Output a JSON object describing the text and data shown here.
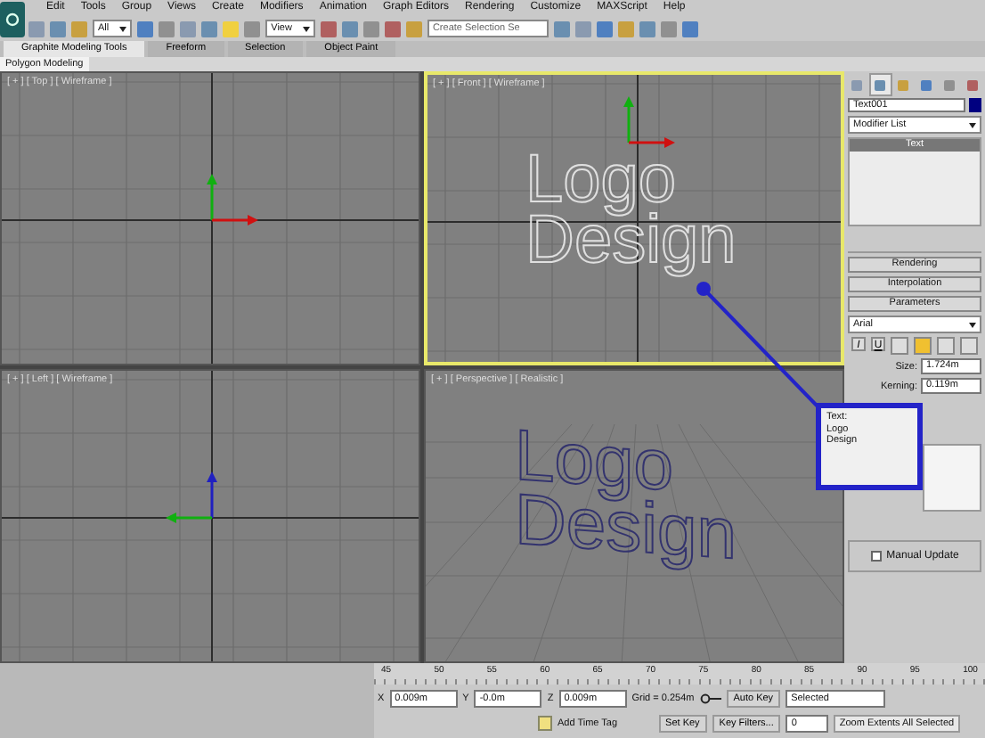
{
  "menu": [
    "Edit",
    "Tools",
    "Group",
    "Views",
    "Create",
    "Modifiers",
    "Animation",
    "Graph Editors",
    "Rendering",
    "Customize",
    "MAXScript",
    "Help"
  ],
  "toolbar": {
    "selection_filter": "All",
    "reference_coord": "View",
    "selection_set_placeholder": "Create Selection Se"
  },
  "ribbon": {
    "tabs": [
      {
        "label": "Graphite Modeling Tools",
        "selected": true
      },
      {
        "label": "Freeform",
        "selected": false
      },
      {
        "label": "Selection",
        "selected": false
      },
      {
        "label": "Object Paint",
        "selected": false
      }
    ],
    "panel_tab": "Polygon Modeling"
  },
  "viewports": [
    {
      "label": "[ + ] [ Top ] [ Wireframe ]",
      "active": false,
      "kind": "plan"
    },
    {
      "label": "[ + ] [ Front ] [ Wireframe ]",
      "active": true,
      "kind": "elevation",
      "text_lines": [
        "Logo",
        "Design"
      ]
    },
    {
      "label": "[ + ] [ Left ] [ Wireframe ]",
      "active": false,
      "kind": "side"
    },
    {
      "label": "[ + ] [ Perspective ] [ Realistic ]",
      "active": false,
      "kind": "perspective",
      "text_lines": [
        "Logo",
        "Design"
      ]
    }
  ],
  "command_panel": {
    "tabs": [
      {
        "selected": false
      },
      {
        "selected": true
      },
      {
        "selected": false
      },
      {
        "selected": false
      },
      {
        "selected": false
      },
      {
        "selected": false
      }
    ],
    "object_name": "Text001",
    "modifier_list": "Modifier List",
    "stack": [
      {
        "label": "Text",
        "selected": true
      }
    ],
    "rollouts": [
      "Rendering",
      "Interpolation",
      "Parameters"
    ],
    "font": "Arial",
    "style_buttons": [
      {
        "label": "I",
        "selected": false
      },
      {
        "label": "U",
        "selected": false
      }
    ],
    "align_buttons": [
      {
        "selected": false
      },
      {
        "selected": true
      },
      {
        "selected": false
      },
      {
        "selected": false
      }
    ],
    "spinners": [
      {
        "label": "Size:",
        "value": "1.724m"
      },
      {
        "label": "Kerning:",
        "value": "0.119m"
      }
    ],
    "manual_update": {
      "label": "Manual Update",
      "checked": false
    }
  },
  "callout": {
    "label": "Text:",
    "lines": [
      "Logo",
      "Design"
    ]
  },
  "timeline": {
    "ticks": [
      "45",
      "50",
      "55",
      "60",
      "65",
      "70",
      "75",
      "80",
      "85",
      "90",
      "95",
      "100"
    ]
  },
  "status": {
    "coords": [
      {
        "axis": "X",
        "value": "0.009m"
      },
      {
        "axis": "Y",
        "value": "-0.0m"
      },
      {
        "axis": "Z",
        "value": "0.009m"
      }
    ],
    "grid": "Grid = 0.254m",
    "time_tag": "Add Time Tag",
    "auto_key": "Auto Key",
    "key_mode": "Selected",
    "set_key": "Set Key",
    "key_filters": "Key Filters...",
    "frame": "0",
    "prompt": "Zoom Extents All Selected"
  }
}
